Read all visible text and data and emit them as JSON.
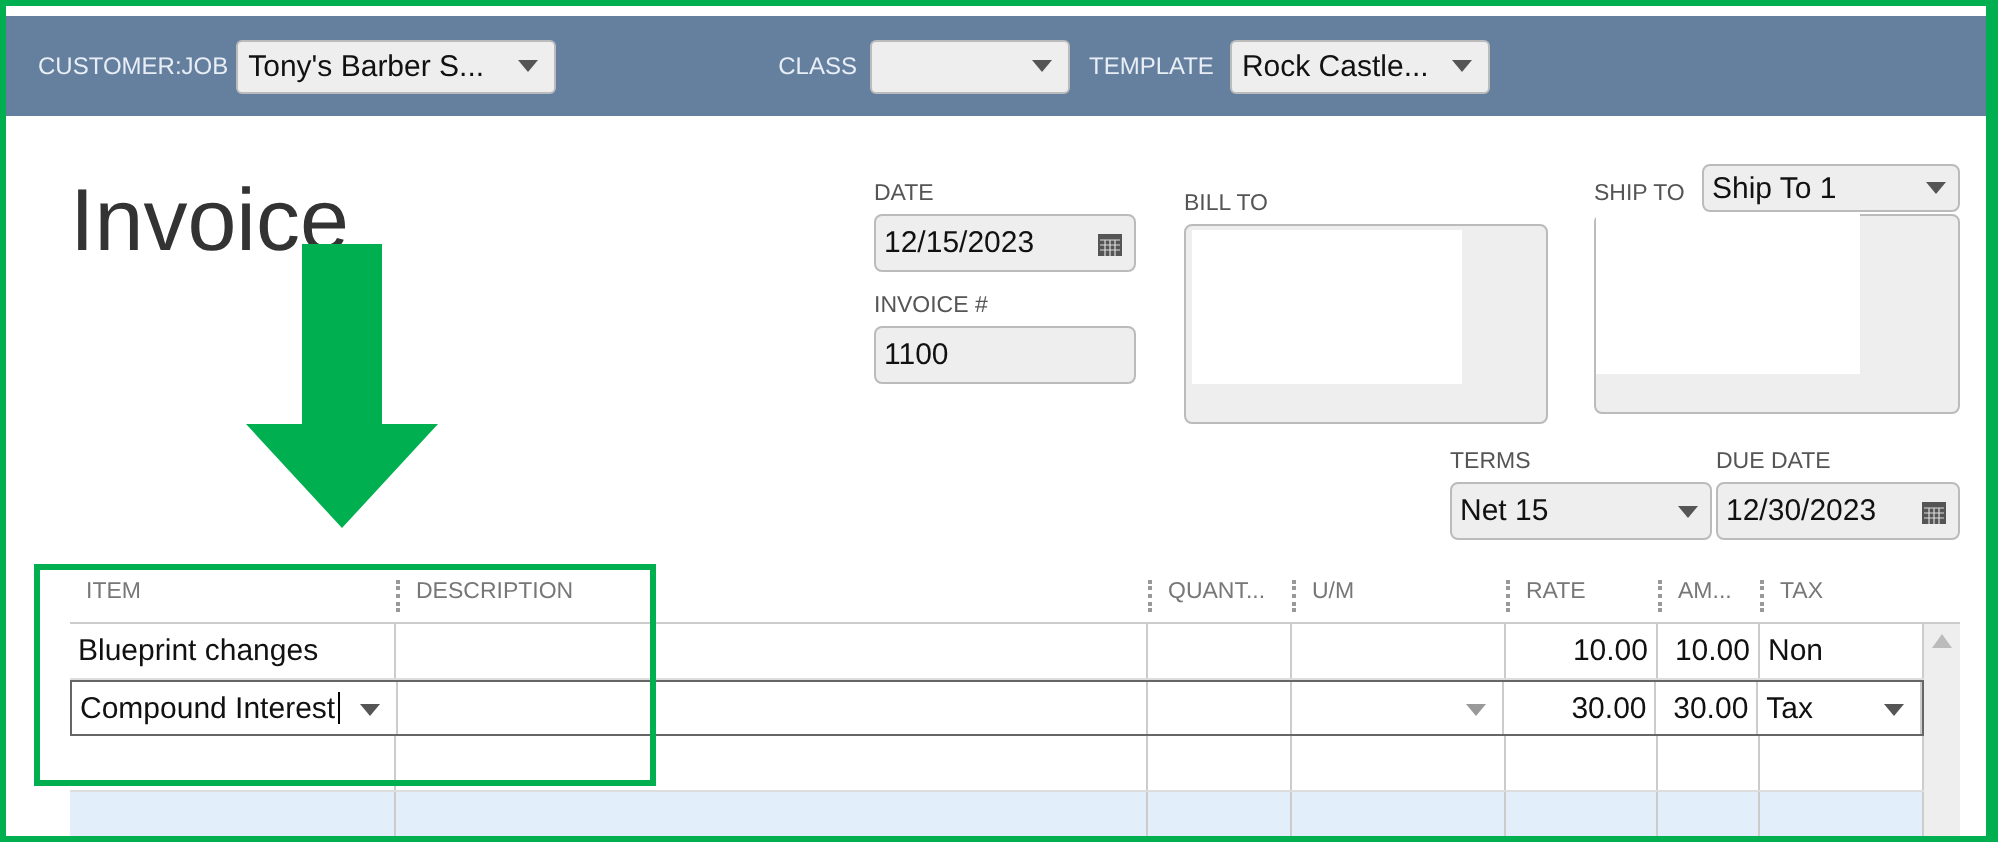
{
  "header": {
    "fields": [
      {
        "kind": "dropdown",
        "label": "CUSTOMER:JOB",
        "value": "Tony's Barber S..."
      },
      {
        "kind": "dropdown",
        "label": "CLASS"
      },
      {
        "kind": "dropdown",
        "label": "TEMPLATE",
        "value": "Rock Castle..."
      }
    ]
  },
  "title": "Invoice",
  "date": {
    "label": "DATE",
    "value": "12/15/2023"
  },
  "invoice_number": {
    "label": "INVOICE #",
    "value": "1100"
  },
  "bill_to": {
    "label": "BILL TO"
  },
  "ship_to": {
    "label": "SHIP TO",
    "value": "Ship To 1"
  },
  "terms": {
    "label": "TERMS",
    "value": "Net 15"
  },
  "due_date": {
    "label": "DUE DATE",
    "value": "12/30/2023"
  },
  "table": {
    "columns": [
      "ITEM",
      "DESCRIPTION",
      "QUANT...",
      "U/M",
      "RATE",
      "AM...",
      "TAX"
    ],
    "rows": [
      {
        "item": "Blueprint changes",
        "rate": "10.00",
        "amount": "10.00",
        "tax": "Non",
        "selected": false
      },
      {
        "item": "Compound Interest",
        "rate": "30.00",
        "amount": "30.00",
        "tax": "Tax",
        "selected": true
      }
    ]
  }
}
